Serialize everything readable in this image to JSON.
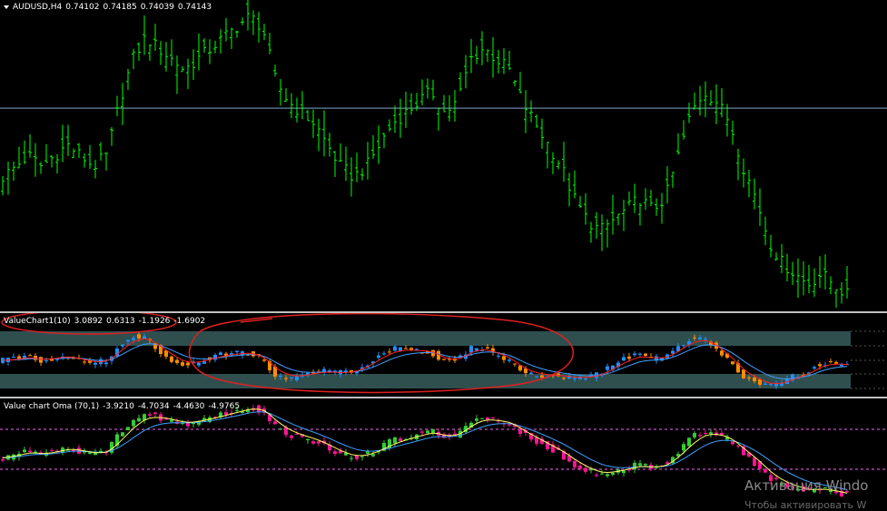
{
  "main": {
    "symbol": "AUDUSD,H4",
    "open": "0.74102",
    "high": "0.74185",
    "low": "0.74039",
    "close": "0.74143",
    "bar_color": "#00ff00",
    "price_line_color": "#7fa7c9"
  },
  "vc1": {
    "name": "ValueChart1(10)",
    "v1": "3.0892",
    "v2": "0.6313",
    "v3": "-1.1926",
    "v4": "-1.6902",
    "zone_color": "#2f4f4f",
    "up_color": "#1e90ff",
    "down_color": "#ff8c00",
    "ma_fast_color": "#ff2020",
    "ma_slow_color": "#3fa0ff",
    "annotation_color": "#e02020"
  },
  "oma": {
    "name": "Value chart Oma (70,1)",
    "v1": "-3.9210",
    "v2": "-4.7034",
    "v3": "-4.4630",
    "v4": "-4.9765",
    "up_color": "#32cd32",
    "down_color": "#ff1493",
    "fast_color": "#ffff66",
    "slow_color": "#3fa0ff",
    "level_color": "#ff60ff"
  },
  "watermark": {
    "line1": "Активация Windo",
    "line2": "Чтобы активировать W"
  },
  "chart_data": [
    {
      "type": "ohlc",
      "symbol": "AUDUSD",
      "timeframe": "H4",
      "last": {
        "open": 0.74102,
        "high": 0.74185,
        "low": 0.74039,
        "close": 0.74143
      },
      "trend_close": [
        0.735,
        0.736,
        0.737,
        0.736,
        0.737,
        0.738,
        0.737,
        0.736,
        0.737,
        0.742,
        0.746,
        0.748,
        0.747,
        0.746,
        0.745,
        0.746,
        0.747,
        0.748,
        0.749,
        0.75,
        0.749,
        0.744,
        0.742,
        0.741,
        0.74,
        0.738,
        0.736,
        0.735,
        0.736,
        0.738,
        0.74,
        0.741,
        0.742,
        0.743,
        0.741,
        0.742,
        0.746,
        0.747,
        0.746,
        0.745,
        0.742,
        0.74,
        0.738,
        0.736,
        0.733,
        0.731,
        0.73,
        0.731,
        0.732,
        0.733,
        0.732,
        0.733,
        0.737,
        0.741,
        0.743,
        0.742,
        0.74,
        0.736,
        0.733,
        0.729,
        0.727,
        0.726,
        0.725,
        0.726,
        0.725,
        0.724
      ]
    }
  ]
}
